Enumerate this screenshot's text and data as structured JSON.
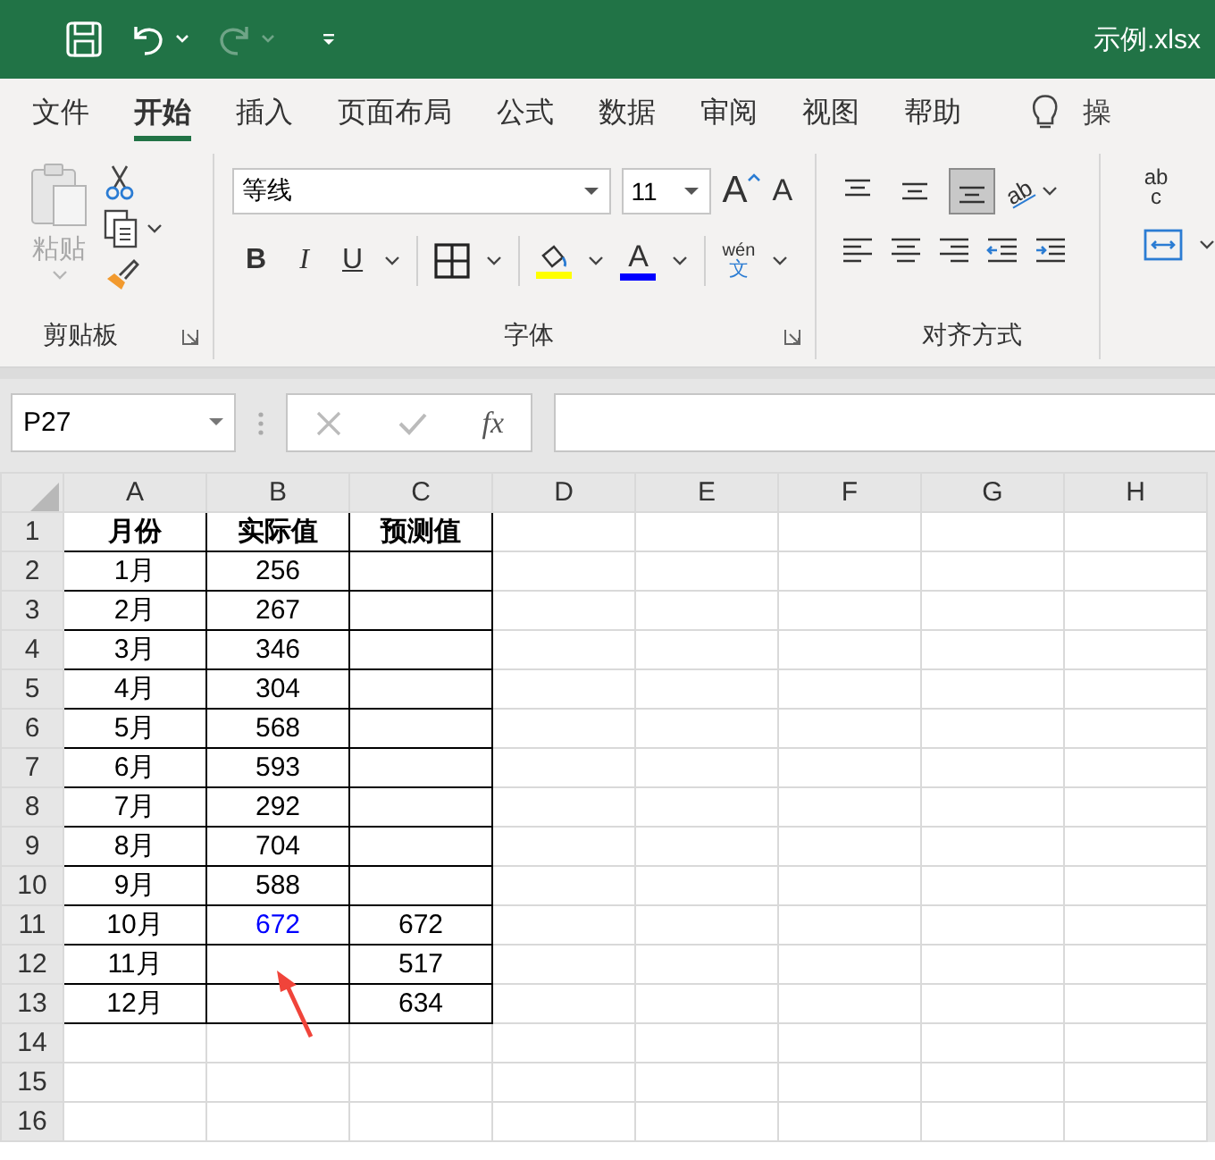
{
  "title_bar": {
    "filename": "示例.xlsx",
    "redo_disabled": true
  },
  "ribbon_tabs": [
    {
      "label": "文件",
      "selected": false
    },
    {
      "label": "开始",
      "selected": true
    },
    {
      "label": "插入",
      "selected": false
    },
    {
      "label": "页面布局",
      "selected": false
    },
    {
      "label": "公式",
      "selected": false
    },
    {
      "label": "数据",
      "selected": false
    },
    {
      "label": "审阅",
      "selected": false
    },
    {
      "label": "视图",
      "selected": false
    },
    {
      "label": "帮助",
      "selected": false
    }
  ],
  "tell_me": "操",
  "clipboard": {
    "paste_label": "粘贴",
    "paste_disabled": true,
    "group_label": "剪贴板"
  },
  "font": {
    "name": "等线",
    "size": "11",
    "grow": "A",
    "shrink": "A",
    "bold": "B",
    "italic": "I",
    "underline": "U",
    "font_color_letter": "A",
    "phonetic_top": "wén",
    "phonetic_bottom": "文",
    "group_label": "字体"
  },
  "alignment": {
    "vertical_buttons": [
      {
        "selected": false
      },
      {
        "selected": false
      },
      {
        "selected": true
      }
    ],
    "orientation_text": "ab",
    "group_label": "对齐方式"
  },
  "wrap_text": {
    "top": "ab",
    "bottom": "c"
  },
  "name_box": "P27",
  "formula_bar": {
    "fx": "fx"
  },
  "columns": [
    "A",
    "B",
    "C",
    "D",
    "E",
    "F",
    "G",
    "H"
  ],
  "rows": [
    {
      "number": "1",
      "header": true,
      "bordered": true,
      "A": "月份",
      "B": "实际值",
      "C": "预测值"
    },
    {
      "number": "2",
      "bordered": true,
      "A": "1月",
      "B": "256"
    },
    {
      "number": "3",
      "bordered": true,
      "A": "2月",
      "B": "267"
    },
    {
      "number": "4",
      "bordered": true,
      "A": "3月",
      "B": "346"
    },
    {
      "number": "5",
      "bordered": true,
      "A": "4月",
      "B": "304"
    },
    {
      "number": "6",
      "bordered": true,
      "A": "5月",
      "B": "568"
    },
    {
      "number": "7",
      "bordered": true,
      "A": "6月",
      "B": "593"
    },
    {
      "number": "8",
      "bordered": true,
      "A": "7月",
      "B": "292"
    },
    {
      "number": "9",
      "bordered": true,
      "A": "8月",
      "B": "704"
    },
    {
      "number": "10",
      "bordered": true,
      "A": "9月",
      "B": "588"
    },
    {
      "number": "11",
      "bordered": true,
      "A": "10月",
      "B": "672",
      "B_highlighted": true,
      "C": "672"
    },
    {
      "number": "12",
      "bordered": true,
      "A": "11月",
      "C": "517"
    },
    {
      "number": "13",
      "bordered": true,
      "A": "12月",
      "C": "634"
    },
    {
      "number": "14",
      "bordered": false
    },
    {
      "number": "15",
      "bordered": false
    },
    {
      "number": "16",
      "bordered": false
    }
  ],
  "annotation_arrow": true
}
